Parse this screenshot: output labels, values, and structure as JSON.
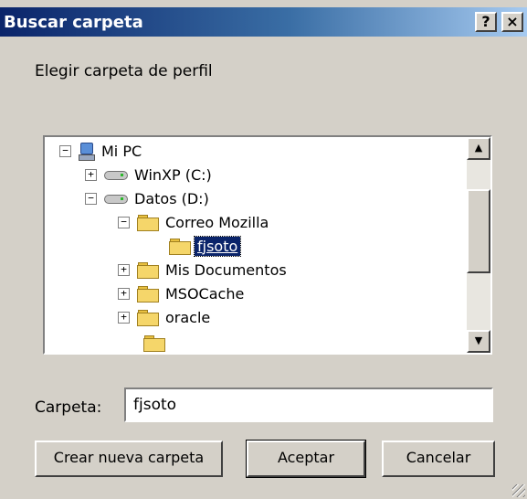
{
  "window": {
    "title": "Buscar carpeta",
    "help_label": "?",
    "close_label": "×"
  },
  "instruction": "Elegir carpeta de perfil",
  "tree": {
    "items": [
      {
        "label": "Mi PC",
        "expander": "−",
        "icon": "computer-icon"
      },
      {
        "label": "WinXP (C:)",
        "expander": "+",
        "icon": "drive-icon"
      },
      {
        "label": "Datos (D:)",
        "expander": "−",
        "icon": "drive-icon"
      },
      {
        "label": "Correo Mozilla",
        "expander": "−",
        "icon": "folder-icon"
      },
      {
        "label": "fjsoto",
        "expander": "",
        "icon": "folder-open-icon",
        "selected": true
      },
      {
        "label": "Mis Documentos",
        "expander": "+",
        "icon": "folder-icon"
      },
      {
        "label": "MSOCache",
        "expander": "+",
        "icon": "folder-icon"
      },
      {
        "label": "oracle",
        "expander": "+",
        "icon": "folder-icon"
      }
    ]
  },
  "folder_field": {
    "label": "Carpeta:",
    "value": "fjsoto"
  },
  "buttons": {
    "new_folder": "Crear nueva carpeta",
    "ok": "Aceptar",
    "cancel": "Cancelar"
  },
  "colors": {
    "titlebar_start": "#0a246a",
    "titlebar_end": "#a6caf0",
    "selection": "#0a246a",
    "dialog_face": "#d4d0c8"
  }
}
